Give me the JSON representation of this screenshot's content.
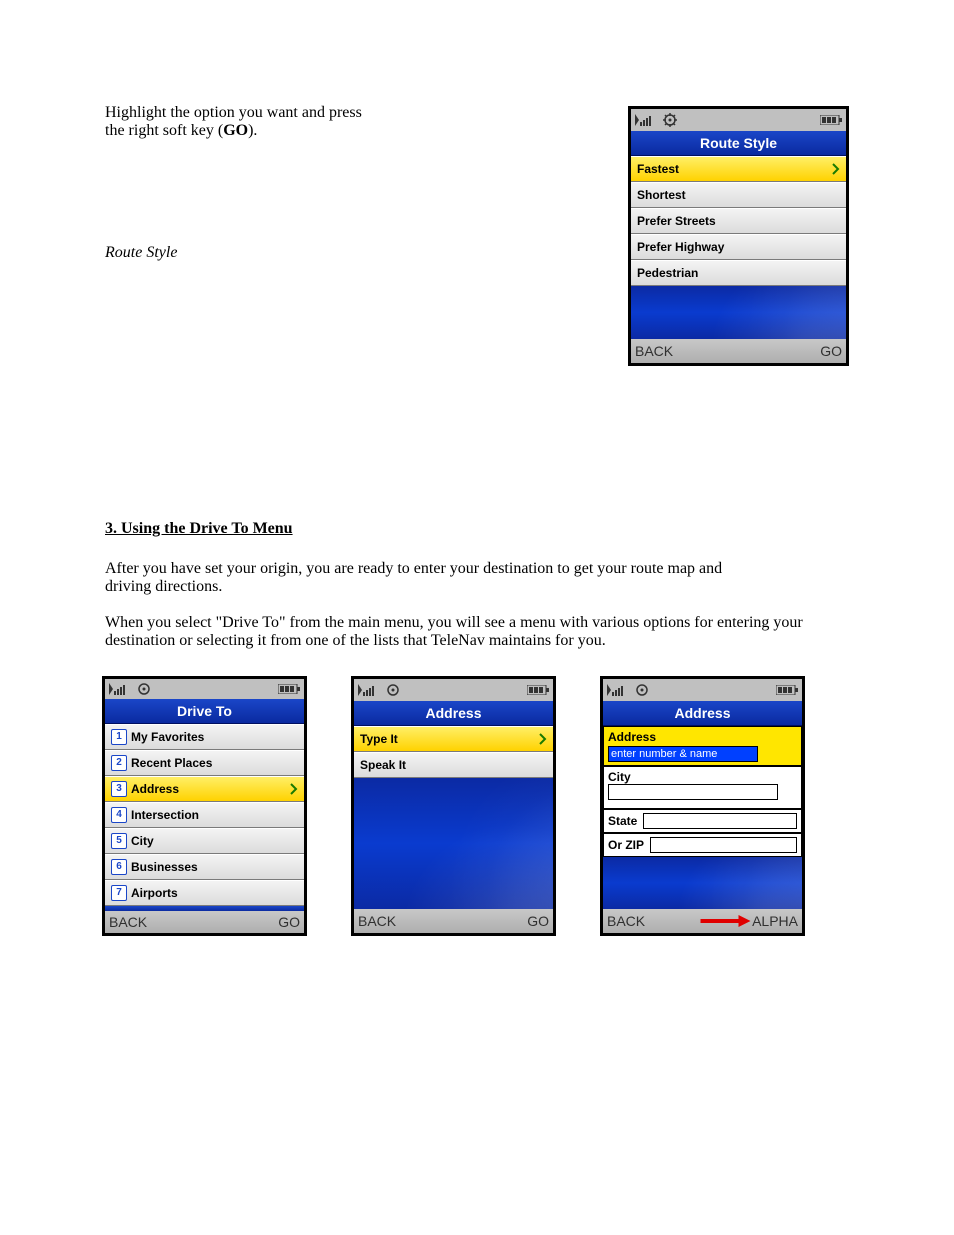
{
  "text": {
    "p1": "Highlight the option you want and press",
    "p2": "the right soft key (",
    "p2_go": "GO",
    "p2_tail": ").",
    "h_routestyle": "Route Style",
    "s3a": "3. Using the Drive To Menu",
    "s3b": "After you have set your origin, you are ready to enter your destination to get your route map and",
    "s3c": "driving directions.",
    "s3d": "When you select \"Drive To\" from the main menu, ",
    "s3e": "you will see a menu with various options for entering ",
    "s3f": "your destination or selecting it from one of the lists that ",
    "s3g": "TeleNav maintains for you."
  },
  "screens": {
    "routestyle": {
      "title": "Route Style",
      "items": [
        "Fastest",
        "Shortest",
        "Prefer Streets",
        "Prefer Highway",
        "Pedestrian"
      ],
      "back": "BACK",
      "go": "GO"
    },
    "driveto": {
      "title": "Drive To",
      "items": [
        {
          "n": "1",
          "label": "My Favorites"
        },
        {
          "n": "2",
          "label": "Recent Places"
        },
        {
          "n": "3",
          "label": "Address"
        },
        {
          "n": "4",
          "label": "Intersection"
        },
        {
          "n": "5",
          "label": "City"
        },
        {
          "n": "6",
          "label": "Businesses"
        },
        {
          "n": "7",
          "label": "Airports"
        }
      ],
      "back": "BACK",
      "go": "GO"
    },
    "address_menu": {
      "title": "Address",
      "items": [
        "Type It",
        "Speak It"
      ],
      "back": "BACK",
      "go": "GO"
    },
    "address_form": {
      "title": "Address",
      "address_label": "Address",
      "address_value": "enter number & name",
      "city_label": "City",
      "state_label": "State",
      "zip_label": "Or ZIP",
      "back": "BACK",
      "right": "ALPHA"
    }
  },
  "icons": {
    "signal": "signal-icon",
    "gear": "gear-icon",
    "battery": "battery-icon",
    "chevron": "chevron-right-icon",
    "arrow": "red-arrow-icon"
  }
}
